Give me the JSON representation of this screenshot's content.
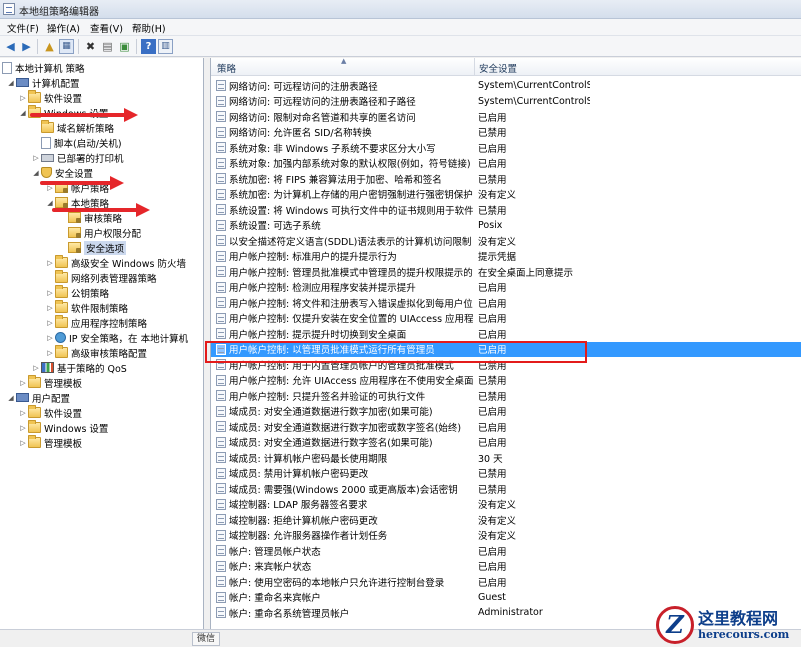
{
  "window": {
    "title": "本地组策略编辑器"
  },
  "menu": [
    "文件(F)",
    "操作(A)",
    "查看(V)",
    "帮助(H)"
  ],
  "toolbar": {
    "icons": [
      "back-arrow-icon",
      "forward-arrow-icon",
      "up-folder-icon",
      "show-hide-tree-icon",
      "delete-icon",
      "properties-icon",
      "export-list-icon",
      "help-icon",
      "show-hide-action-pane-icon"
    ]
  },
  "tree": {
    "root": "本地计算机 策略",
    "computer_config": "计算机配置",
    "software_settings": "软件设置",
    "windows_settings": "Windows 设置",
    "name_resolution": "域名解析策略",
    "scripts": "脚本(启动/关机)",
    "deployed_printers": "已部署的打印机",
    "security_settings": "安全设置",
    "account_policies": "帐户策略",
    "local_policies": "本地策略",
    "audit_policy": "审核策略",
    "user_rights": "用户权限分配",
    "security_options": "安全选项",
    "firewall": "高级安全 Windows 防火墙",
    "network_list": "网络列表管理器策略",
    "public_key": "公钥策略",
    "software_restriction": "软件限制策略",
    "app_control": "应用程序控制策略",
    "ipsec": "IP 安全策略，在 本地计算机",
    "advanced_audit": "高级审核策略配置",
    "qos": "基于策略的 QoS",
    "admin_templates": "管理模板",
    "user_config": "用户配置",
    "u_software_settings": "软件设置",
    "u_windows_settings": "Windows 设置",
    "u_admin_templates": "管理模板"
  },
  "list": {
    "col_policy": "策略",
    "col_setting": "安全设置",
    "rows": [
      {
        "policy": "网络访问: 可远程访问的注册表路径",
        "setting": "System\\CurrentControlSet..."
      },
      {
        "policy": "网络访问: 可远程访问的注册表路径和子路径",
        "setting": "System\\CurrentControlSet..."
      },
      {
        "policy": "网络访问: 限制对命名管道和共享的匿名访问",
        "setting": "已启用"
      },
      {
        "policy": "网络访问: 允许匿名 SID/名称转换",
        "setting": "已禁用"
      },
      {
        "policy": "系统对象: 非 Windows 子系统不要求区分大小写",
        "setting": "已启用"
      },
      {
        "policy": "系统对象: 加强内部系统对象的默认权限(例如，符号链接)",
        "setting": "已启用"
      },
      {
        "policy": "系统加密: 将 FIPS 兼容算法用于加密、哈希和签名",
        "setting": "已禁用"
      },
      {
        "policy": "系统加密: 为计算机上存储的用户密钥强制进行强密钥保护",
        "setting": "没有定义"
      },
      {
        "policy": "系统设置: 将 Windows 可执行文件中的证书规则用于软件限制策略",
        "setting": "已禁用"
      },
      {
        "policy": "系统设置: 可选子系统",
        "setting": "Posix"
      },
      {
        "policy": "以安全描述符定义语言(SDDL)语法表示的计算机访问限制",
        "setting": "没有定义"
      },
      {
        "policy": "用户帐户控制: 标准用户的提升提示行为",
        "setting": "提示凭据"
      },
      {
        "policy": "用户帐户控制: 管理员批准模式中管理员的提升权限提示的行为",
        "setting": "在安全桌面上同意提示"
      },
      {
        "policy": "用户帐户控制: 检测应用程序安装并提示提升",
        "setting": "已启用"
      },
      {
        "policy": "用户帐户控制: 将文件和注册表写入错误虚拟化到每用户位置",
        "setting": "已启用"
      },
      {
        "policy": "用户帐户控制: 仅提升安装在安全位置的 UIAccess 应用程序",
        "setting": "已启用"
      },
      {
        "policy": "用户帐户控制: 提示提升时切换到安全桌面",
        "setting": "已启用"
      },
      {
        "policy": "用户帐户控制: 以管理员批准模式运行所有管理员",
        "setting": "已启用"
      },
      {
        "policy": "用户帐户控制: 用于内置管理员帐户的管理员批准模式",
        "setting": "已禁用"
      },
      {
        "policy": "用户帐户控制: 允许 UIAccess 应用程序在不使用安全桌面的情况下提升权限",
        "setting": "已禁用"
      },
      {
        "policy": "用户帐户控制: 只提升签名并验证的可执行文件",
        "setting": "已禁用"
      },
      {
        "policy": "域成员: 对安全通道数据进行数字加密(如果可能)",
        "setting": "已启用"
      },
      {
        "policy": "域成员: 对安全通道数据进行数字加密或数字签名(始终)",
        "setting": "已启用"
      },
      {
        "policy": "域成员: 对安全通道数据进行数字签名(如果可能)",
        "setting": "已启用"
      },
      {
        "policy": "域成员: 计算机帐户密码最长使用期限",
        "setting": "30 天"
      },
      {
        "policy": "域成员: 禁用计算机帐户密码更改",
        "setting": "已禁用"
      },
      {
        "policy": "域成员: 需要强(Windows 2000 或更高版本)会话密钥",
        "setting": "已禁用"
      },
      {
        "policy": "域控制器: LDAP 服务器签名要求",
        "setting": "没有定义"
      },
      {
        "policy": "域控制器: 拒绝计算机帐户密码更改",
        "setting": "没有定义"
      },
      {
        "policy": "域控制器: 允许服务器操作者计划任务",
        "setting": "没有定义"
      },
      {
        "policy": "帐户: 管理员帐户状态",
        "setting": "已启用"
      },
      {
        "policy": "帐户: 来宾帐户状态",
        "setting": "已启用"
      },
      {
        "policy": "帐户: 使用空密码的本地帐户只允许进行控制台登录",
        "setting": "已启用"
      },
      {
        "policy": "帐户: 重命名来宾帐户",
        "setting": "Guest"
      },
      {
        "policy": "帐户: 重命名系统管理员帐户",
        "setting": "Administrator"
      }
    ],
    "highlight_index": 17
  },
  "status": {
    "cell": "微信"
  },
  "watermark": {
    "logo_letter": "Z",
    "cn": "这里教程网",
    "en": "herecours.com"
  },
  "colors": {
    "highlight": "#3399ff",
    "annotation_red": "#e31b1b"
  }
}
